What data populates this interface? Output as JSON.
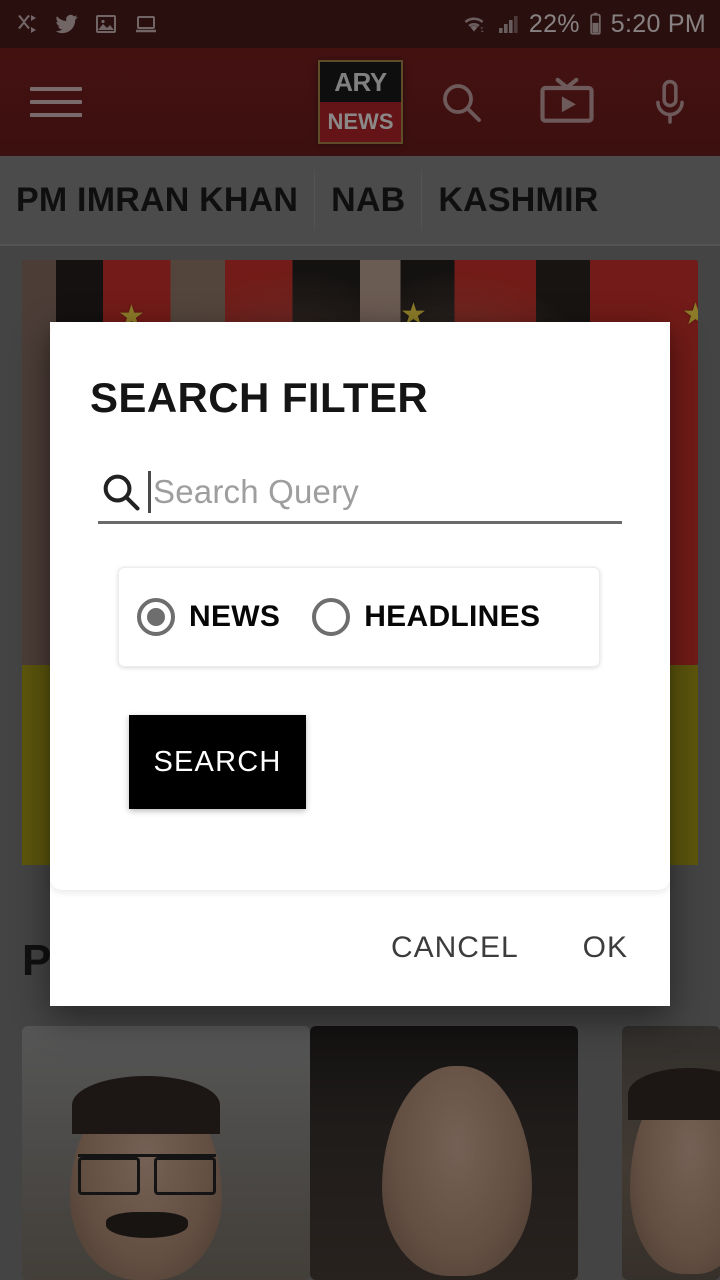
{
  "status_bar": {
    "icons_left": [
      "shuffle-icon",
      "twitter-icon",
      "image-icon",
      "laptop-icon"
    ],
    "wifi_icon": "wifi-icon",
    "signal_icon": "signal-icon",
    "battery_percent": "22%",
    "battery_icon": "battery-icon",
    "time": "5:20 PM"
  },
  "app_bar": {
    "menu_icon": "hamburger-menu-icon",
    "logo_top": "ARY",
    "logo_bottom": "NEWS",
    "search_icon": "search-icon",
    "tv_icon": "live-tv-icon",
    "mic_icon": "microphone-icon"
  },
  "tag_bar": {
    "tags": [
      "PM IMRAN KHAN",
      "NAB",
      "KASHMIR"
    ]
  },
  "feed": {
    "heading": "PA",
    "hero_alt": "imran-khan-xi-jinping-flags"
  },
  "dialog": {
    "title": "SEARCH FILTER",
    "search": {
      "icon": "search-icon",
      "value": "",
      "placeholder": "Search Query"
    },
    "options": [
      {
        "label": "NEWS",
        "checked": true
      },
      {
        "label": "HEADLINES",
        "checked": false
      }
    ],
    "submit_label": "SEARCH",
    "cancel_label": "CANCEL",
    "ok_label": "OK"
  },
  "colors": {
    "status_bar_bg": "#3d0c0c",
    "app_bar_bg": "#6d0f0f",
    "tag_bar_bg": "#7b7b7b",
    "logo_red": "#a8161a",
    "submit_bg": "#000000",
    "radio_gray": "#6e6e6e",
    "scrim": "rgba(20,20,20,0.46)"
  }
}
